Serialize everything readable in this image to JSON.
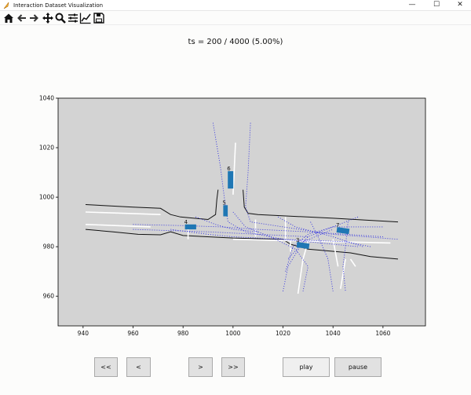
{
  "window": {
    "title": "Interaction Dataset Visualization",
    "minimize_glyph": "—",
    "maximize_glyph": "☐",
    "close_glyph": "✕"
  },
  "toolbar": {
    "icons": [
      "home-icon",
      "back-arrow-icon",
      "forward-arrow-icon",
      "pan-icon",
      "zoom-icon",
      "configure-subplots-icon",
      "edit-axis-icon",
      "save-icon"
    ]
  },
  "plot": {
    "title": "ts = 200 / 4000 (5.00%)"
  },
  "controls": {
    "first_label": "<<",
    "prev_label": "<",
    "next_label": ">",
    "last_label": ">>",
    "play_label": "play",
    "pause_label": "pause"
  },
  "chart_data": {
    "type": "scatter",
    "xlim": [
      930,
      1077
    ],
    "ylim": [
      948,
      1040
    ],
    "xticks": [
      940,
      960,
      980,
      1000,
      1020,
      1040,
      1060
    ],
    "yticks": [
      960,
      980,
      1000,
      1020,
      1040
    ],
    "grid": false,
    "background": "#d3d3d3",
    "vehicle_color": "#1f77b4",
    "vehicles": [
      {
        "id": "4",
        "x": 983,
        "y": 988,
        "w": 4.5,
        "h": 2,
        "angle": 0
      },
      {
        "id": "5",
        "x": 997,
        "y": 994.5,
        "w": 1.8,
        "h": 4.5,
        "angle": 0
      },
      {
        "id": "6",
        "x": 999,
        "y": 1007,
        "w": 2.2,
        "h": 7,
        "angle": 0
      },
      {
        "id": "3",
        "x": 1028,
        "y": 980.5,
        "w": 5,
        "h": 2.2,
        "angle": 8
      },
      {
        "id": "7",
        "x": 1044,
        "y": 986.5,
        "w": 5,
        "h": 2.2,
        "angle": 8
      }
    ],
    "lanes": {
      "dark_boundaries": [
        [
          [
            941,
            997
          ],
          [
            960,
            996
          ],
          [
            971,
            995.5
          ],
          [
            975,
            993
          ],
          [
            979,
            992
          ],
          [
            990,
            991
          ],
          [
            993,
            993
          ],
          [
            993.5,
            999
          ],
          [
            994,
            1003
          ]
        ],
        [
          [
            941,
            987
          ],
          [
            952,
            986
          ],
          [
            962,
            985
          ],
          [
            971,
            984.8
          ],
          [
            975,
            986
          ],
          [
            980,
            984.5
          ],
          [
            1000,
            983.5
          ],
          [
            1020,
            983
          ],
          [
            1023,
            981
          ],
          [
            1030,
            979
          ],
          [
            1047,
            977.5
          ],
          [
            1055,
            976
          ],
          [
            1066,
            975
          ]
        ],
        [
          [
            1004,
            1003
          ],
          [
            1004.5,
            996
          ],
          [
            1006,
            993.5
          ],
          [
            1010,
            993
          ],
          [
            1040,
            991.5
          ],
          [
            1066,
            990
          ]
        ]
      ],
      "white_lines": [
        [
          [
            941,
            994
          ],
          [
            971,
            993
          ]
        ],
        [
          [
            941,
            989
          ],
          [
            967,
            988
          ]
        ],
        [
          [
            1001,
            1022
          ],
          [
            1000,
            1001
          ]
        ],
        [
          [
            1021,
            992
          ],
          [
            1021,
            983
          ]
        ],
        [
          [
            1028,
            975
          ],
          [
            1030,
            982
          ]
        ],
        [
          [
            1023,
            983
          ],
          [
            1023,
            978
          ]
        ],
        [
          [
            1000,
            983
          ],
          [
            1063,
            981.5
          ]
        ],
        [
          [
            1040,
            983
          ],
          [
            1042,
            972
          ]
        ],
        [
          [
            1047,
            975
          ],
          [
            1049,
            972
          ]
        ],
        [
          [
            982,
            987
          ],
          [
            982,
            983
          ]
        ],
        [
          [
            1009,
            991
          ],
          [
            1009,
            984
          ]
        ],
        [
          [
            1026,
            961
          ],
          [
            1028,
            975
          ]
        ],
        [
          [
            1043,
            963
          ],
          [
            1045,
            975
          ]
        ]
      ],
      "blue_paths": [
        [
          [
            992,
            1030
          ],
          [
            995,
            1012
          ],
          [
            997,
            996
          ],
          [
            998,
            990
          ],
          [
            1005,
            986
          ],
          [
            1020,
            983
          ],
          [
            1050,
            980
          ]
        ],
        [
          [
            1007,
            1030
          ],
          [
            1006,
            1010
          ],
          [
            1005,
            996
          ],
          [
            1007,
            990
          ],
          [
            1020,
            988
          ],
          [
            1040,
            985
          ],
          [
            1066,
            983
          ]
        ],
        [
          [
            960,
            989
          ],
          [
            980,
            988.5
          ],
          [
            995,
            988
          ],
          [
            1010,
            987
          ],
          [
            1030,
            986
          ],
          [
            1060,
            984
          ]
        ],
        [
          [
            960,
            987
          ],
          [
            990,
            986
          ],
          [
            1000,
            985.5
          ],
          [
            1030,
            984
          ]
        ],
        [
          [
            1000,
            994
          ],
          [
            1005,
            988
          ],
          [
            1015,
            984
          ],
          [
            1025,
            979
          ],
          [
            1030,
            972
          ],
          [
            1028,
            962
          ]
        ],
        [
          [
            1031,
            990
          ],
          [
            1035,
            982
          ],
          [
            1038,
            975
          ],
          [
            1040,
            962
          ]
        ],
        [
          [
            1046,
            990
          ],
          [
            1045,
            980
          ],
          [
            1044,
            972
          ],
          [
            1045,
            962
          ]
        ],
        [
          [
            1021,
            970
          ],
          [
            1024,
            980
          ],
          [
            1030,
            985
          ],
          [
            1040,
            988
          ],
          [
            1060,
            988
          ]
        ],
        [
          [
            1018,
            992
          ],
          [
            1025,
            988
          ],
          [
            1040,
            984
          ],
          [
            1052,
            980
          ]
        ],
        [
          [
            1050,
            992
          ],
          [
            1040,
            988
          ],
          [
            1030,
            984
          ],
          [
            1022,
            975
          ]
        ],
        [
          [
            1020,
            962
          ],
          [
            1022,
            972
          ],
          [
            1028,
            982
          ],
          [
            1040,
            987
          ]
        ],
        [
          [
            985,
            992
          ],
          [
            993,
            989
          ],
          [
            1000,
            987
          ],
          [
            1010,
            986
          ]
        ],
        [
          [
            975,
            987
          ],
          [
            990,
            985
          ],
          [
            1000,
            984
          ],
          [
            1020,
            983
          ],
          [
            1045,
            982
          ],
          [
            1055,
            980
          ]
        ]
      ]
    }
  }
}
